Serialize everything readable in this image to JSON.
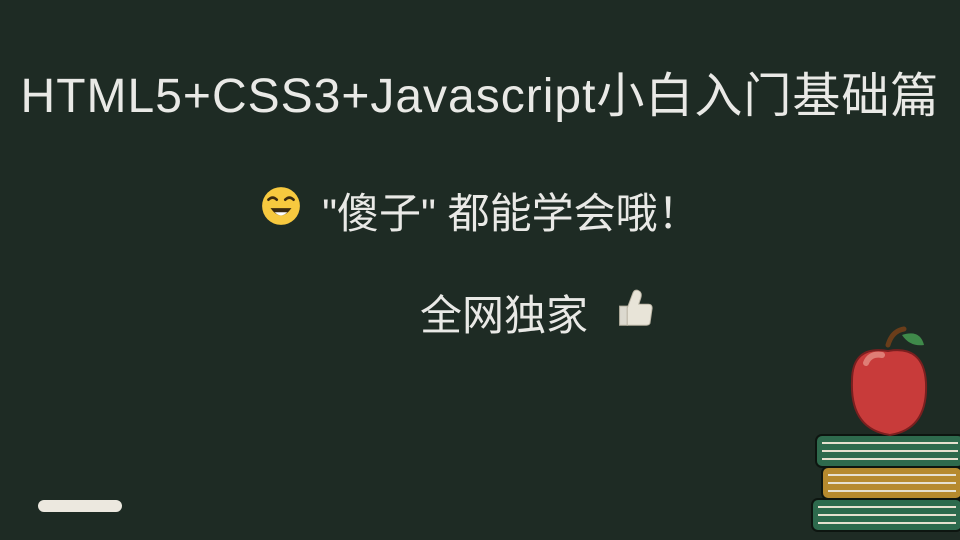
{
  "title": "HTML5+CSS3+Javascript小白入门基础篇",
  "subtitle": "\"傻子\" 都能学会哦！",
  "tagline": "全网独家",
  "icons": {
    "smile": "laughing-face-icon",
    "thumb": "thumbs-up-icon",
    "apple_books": "apple-on-books-icon",
    "chalk": "chalk-mark"
  },
  "colors": {
    "background": "#1e2b24",
    "text": "#e9e9e6",
    "emoji_face": "#f7c93f",
    "apple": "#c83b3a",
    "book1": "#2e6a4d",
    "book2": "#b68a2e",
    "book3": "#2d6a4d"
  }
}
